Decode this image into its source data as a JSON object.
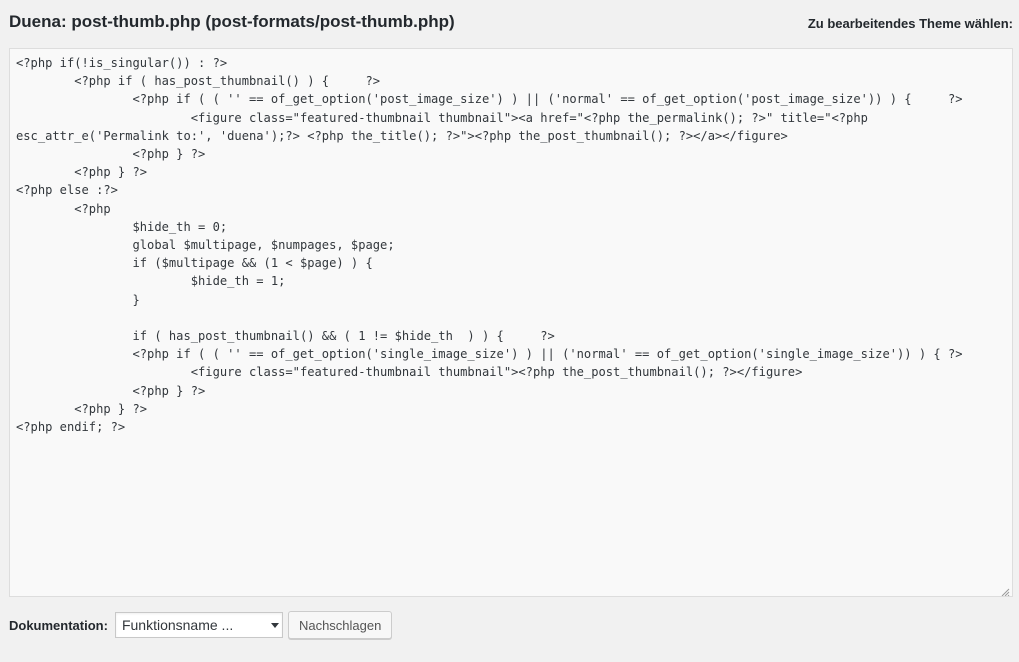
{
  "header": {
    "file_title": "Duena: post-thumb.php (post-formats/post-thumb.php)",
    "theme_select_label": "Zu bearbeitendes Theme wählen:"
  },
  "editor": {
    "content": "<?php if(!is_singular()) : ?>\n\t<?php if ( has_post_thumbnail() ) {\t?>\n\t\t<?php if ( ( '' == of_get_option('post_image_size') ) || ('normal' == of_get_option('post_image_size')) ) {\t?>\n\t\t\t<figure class=\"featured-thumbnail thumbnail\"><a href=\"<?php the_permalink(); ?>\" title=\"<?php esc_attr_e('Permalink to:', 'duena');?> <?php the_title(); ?>\"><?php the_post_thumbnail(); ?></a></figure>\n\t\t<?php } ?>\n\t<?php } ?>\n<?php else :?>\n\t<?php\n\t\t$hide_th = 0;\n\t\tglobal $multipage, $numpages, $page;\n\t\tif ($multipage && (1 < $page) ) {\n\t\t\t$hide_th = 1;\n\t\t}\n\n\t\tif ( has_post_thumbnail() && ( 1 != $hide_th  ) ) {\t?>\n\t\t<?php if ( ( '' == of_get_option('single_image_size') ) || ('normal' == of_get_option('single_image_size')) ) { ?>\n\t\t\t<figure class=\"featured-thumbnail thumbnail\"><?php the_post_thumbnail(); ?></figure>\n\t\t<?php } ?>\n\t<?php } ?>\n<?php endif; ?>"
  },
  "documentation": {
    "label": "Dokumentation:",
    "select_value": "Funktionsname ...",
    "lookup_button": "Nachschlagen"
  },
  "icons": {
    "dropdown": "chevron-down-icon",
    "resize": "resize-grip-icon"
  },
  "colors": {
    "background": "#f1f1f1",
    "editor_bg": "#f9f9f9",
    "text": "#23282d"
  }
}
